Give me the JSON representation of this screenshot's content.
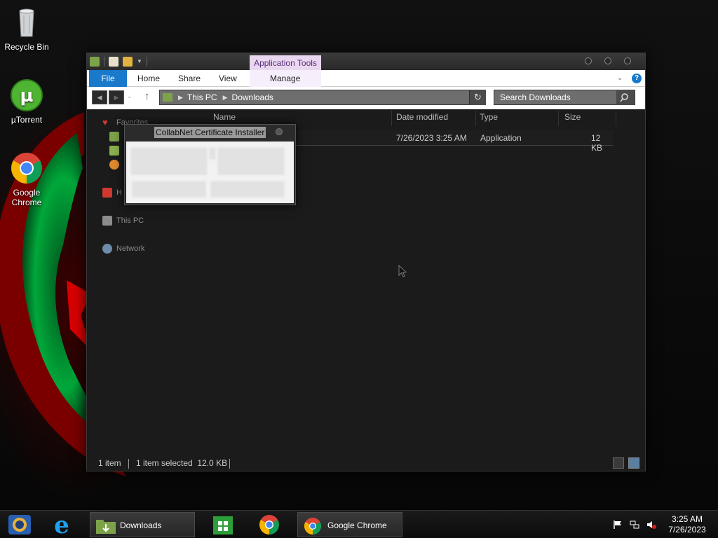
{
  "desktop": {
    "icons": [
      {
        "label": "Recycle Bin",
        "icon": "recycle-bin-icon"
      },
      {
        "label": "µTorrent",
        "icon": "utorrent-icon"
      },
      {
        "label": "Google Chrome",
        "icon": "chrome-icon"
      }
    ]
  },
  "explorer": {
    "contextual_tab": "Application Tools",
    "ribbon_tabs": {
      "file": "File",
      "home": "Home",
      "share": "Share",
      "view": "View",
      "manage": "Manage"
    },
    "breadcrumb": [
      "This PC",
      "Downloads"
    ],
    "search_placeholder": "Search Downloads",
    "nav_pane": {
      "favorites": "Favorites",
      "homegroup": "H",
      "this_pc": "This PC",
      "network": "Network"
    },
    "columns": {
      "name": "Name",
      "date": "Date modified",
      "type": "Type",
      "size": "Size"
    },
    "files": [
      {
        "date": "7/26/2023 3:25 AM",
        "type": "Application",
        "size": "12 KB"
      }
    ],
    "status": {
      "count": "1 item",
      "selected": "1 item selected  12.0 KB"
    }
  },
  "dialog": {
    "title": "CollabNet Certificate Installer"
  },
  "taskbar": {
    "explorer_label": "Downloads",
    "chrome_label": "Google Chrome",
    "time": "3:25 AM",
    "date": "7/26/2023"
  },
  "colors": {
    "file_tab": "#1979ca",
    "contextual_tab": "#e9d7f0",
    "window_bg": "#1b1b1b"
  }
}
